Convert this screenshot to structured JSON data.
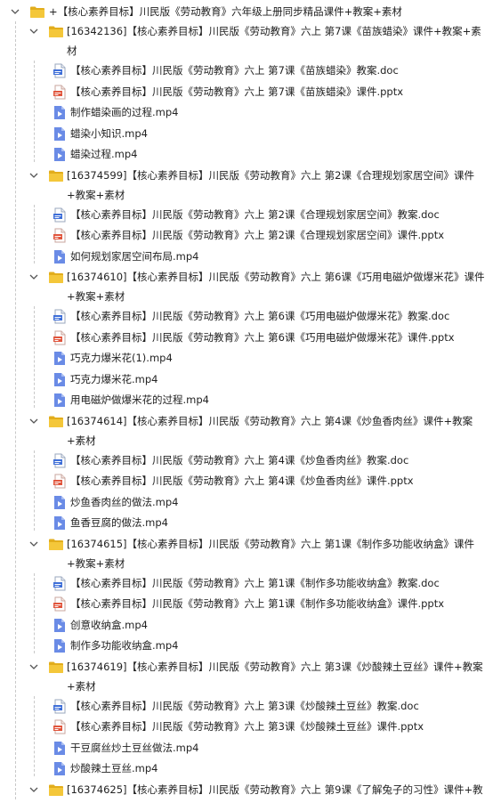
{
  "tree": {
    "root": {
      "label": "+【核心素养目标】川民版《劳动教育》六年级上册同步精品课件+教案+素材",
      "expanded": true,
      "icon": "folder-icon",
      "children": [
        {
          "line1": "[16342136]【核心素养目标】川民版《劳动教育》六上 第7课《苗族蜡染》课件+教案+素",
          "line2": "材",
          "expanded": true,
          "files": [
            {
              "name": "【核心素养目标】川民版《劳动教育》六上 第7课《苗族蜡染》教案.doc",
              "icon": "doc-file-icon"
            },
            {
              "name": "【核心素养目标】川民版《劳动教育》六上 第7课《苗族蜡染》课件.pptx",
              "icon": "ppt-file-icon"
            },
            {
              "name": "制作蜡染画的过程.mp4",
              "icon": "video-file-icon"
            },
            {
              "name": "蜡染小知识.mp4",
              "icon": "video-file-icon"
            },
            {
              "name": "蜡染过程.mp4",
              "icon": "video-file-icon"
            }
          ]
        },
        {
          "line1": "[16374599]【核心素养目标】川民版《劳动教育》六上 第2课《合理规划家居空间》课件",
          "line2": "+教案+素材",
          "expanded": true,
          "files": [
            {
              "name": "【核心素养目标】川民版《劳动教育》六上 第2课《合理规划家居空间》教案.doc",
              "icon": "doc-file-icon"
            },
            {
              "name": "【核心素养目标】川民版《劳动教育》六上 第2课《合理规划家居空间》课件.pptx",
              "icon": "ppt-file-icon"
            },
            {
              "name": "如何规划家居空间布局.mp4",
              "icon": "video-file-icon"
            }
          ]
        },
        {
          "line1": "[16374610]【核心素养目标】川民版《劳动教育》六上 第6课《巧用电磁炉做爆米花》课件",
          "line2": "+教案+素材",
          "expanded": true,
          "files": [
            {
              "name": "【核心素养目标】川民版《劳动教育》六上 第6课《巧用电磁炉做爆米花》教案.doc",
              "icon": "doc-file-icon"
            },
            {
              "name": "【核心素养目标】川民版《劳动教育》六上 第6课《巧用电磁炉做爆米花》课件.pptx",
              "icon": "ppt-file-icon"
            },
            {
              "name": "巧克力爆米花(1).mp4",
              "icon": "video-file-icon"
            },
            {
              "name": "巧克力爆米花.mp4",
              "icon": "video-file-icon"
            },
            {
              "name": "用电磁炉做爆米花的过程.mp4",
              "icon": "video-file-icon"
            }
          ]
        },
        {
          "line1": "[16374614]【核心素养目标】川民版《劳动教育》六上 第4课《炒鱼香肉丝》课件+教案",
          "line2": "+素材",
          "expanded": true,
          "files": [
            {
              "name": "【核心素养目标】川民版《劳动教育》六上 第4课《炒鱼香肉丝》教案.doc",
              "icon": "doc-file-icon"
            },
            {
              "name": "【核心素养目标】川民版《劳动教育》六上 第4课《炒鱼香肉丝》课件.pptx",
              "icon": "ppt-file-icon"
            },
            {
              "name": "炒鱼香肉丝的做法.mp4",
              "icon": "video-file-icon"
            },
            {
              "name": "鱼香豆腐的做法.mp4",
              "icon": "video-file-icon"
            }
          ]
        },
        {
          "line1": "[16374615]【核心素养目标】川民版《劳动教育》六上 第1课《制作多功能收纳盒》课件",
          "line2": "+教案+素材",
          "expanded": true,
          "files": [
            {
              "name": "【核心素养目标】川民版《劳动教育》六上 第1课《制作多功能收纳盒》教案.doc",
              "icon": "doc-file-icon"
            },
            {
              "name": "【核心素养目标】川民版《劳动教育》六上 第1课《制作多功能收纳盒》课件.pptx",
              "icon": "ppt-file-icon"
            },
            {
              "name": "创意收纳盒.mp4",
              "icon": "video-file-icon"
            },
            {
              "name": "制作多功能收纳盒.mp4",
              "icon": "video-file-icon"
            }
          ]
        },
        {
          "line1": "[16374619]【核心素养目标】川民版《劳动教育》六上 第3课《炒酸辣土豆丝》课件+教案",
          "line2": "+素材",
          "expanded": true,
          "files": [
            {
              "name": "【核心素养目标】川民版《劳动教育》六上 第3课《炒酸辣土豆丝》教案.doc",
              "icon": "doc-file-icon"
            },
            {
              "name": "【核心素养目标】川民版《劳动教育》六上 第3课《炒酸辣土豆丝》课件.pptx",
              "icon": "ppt-file-icon"
            },
            {
              "name": "干豆腐丝炒土豆丝做法.mp4",
              "icon": "video-file-icon"
            },
            {
              "name": "炒酸辣土豆丝.mp4",
              "icon": "video-file-icon"
            }
          ]
        },
        {
          "line1": "[16374625]【核心素养目标】川民版《劳动教育》六上 第9课《了解兔子的习性》课件+教",
          "line2": "",
          "expanded": true,
          "files": []
        }
      ]
    }
  },
  "colors": {
    "folder": "#f4c73a",
    "folder_dark": "#e2ad1c",
    "doc": "#3f6fd8",
    "ppt": "#e1553c",
    "video": "#6a8be6",
    "guide": "#c8c8c8",
    "chevron": "#555555"
  }
}
